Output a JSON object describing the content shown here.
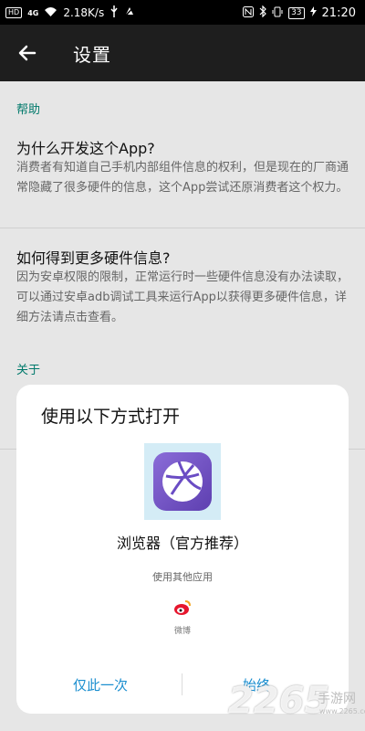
{
  "status_bar": {
    "left_badges": [
      "HD",
      "4G"
    ],
    "speed": "2.18K/s",
    "battery": "33",
    "time": "21:20"
  },
  "app_bar": {
    "title": "设置"
  },
  "settings": {
    "help_header": "帮助",
    "items": [
      {
        "title": "为什么开发这个App?",
        "desc": "消费者有知道自己手机内部组件信息的权利，但是现在的厂商通常隐藏了很多硬件的信息，这个App尝试还原消费者这个权力。"
      },
      {
        "title": "如何得到更多硬件信息?",
        "desc": "因为安卓权限的限制，正常运行时一些硬件信息没有办法读取，可以通过安卓adb调试工具来运行App以获得更多硬件信息，详细方法请点击查看。"
      }
    ],
    "about_header": "关于"
  },
  "dialog": {
    "title": "使用以下方式打开",
    "recommended_app": "浏览器（官方推荐）",
    "other_label": "使用其他应用",
    "other_app": "微博",
    "btn_once": "仅此一次",
    "btn_always": "始终"
  },
  "watermark": {
    "number": "2265",
    "text": "手游网",
    "url": "www.2265.com"
  },
  "colors": {
    "accent": "#00796b",
    "button": "#1a8ecf",
    "appbar": "#1e1e1e"
  }
}
